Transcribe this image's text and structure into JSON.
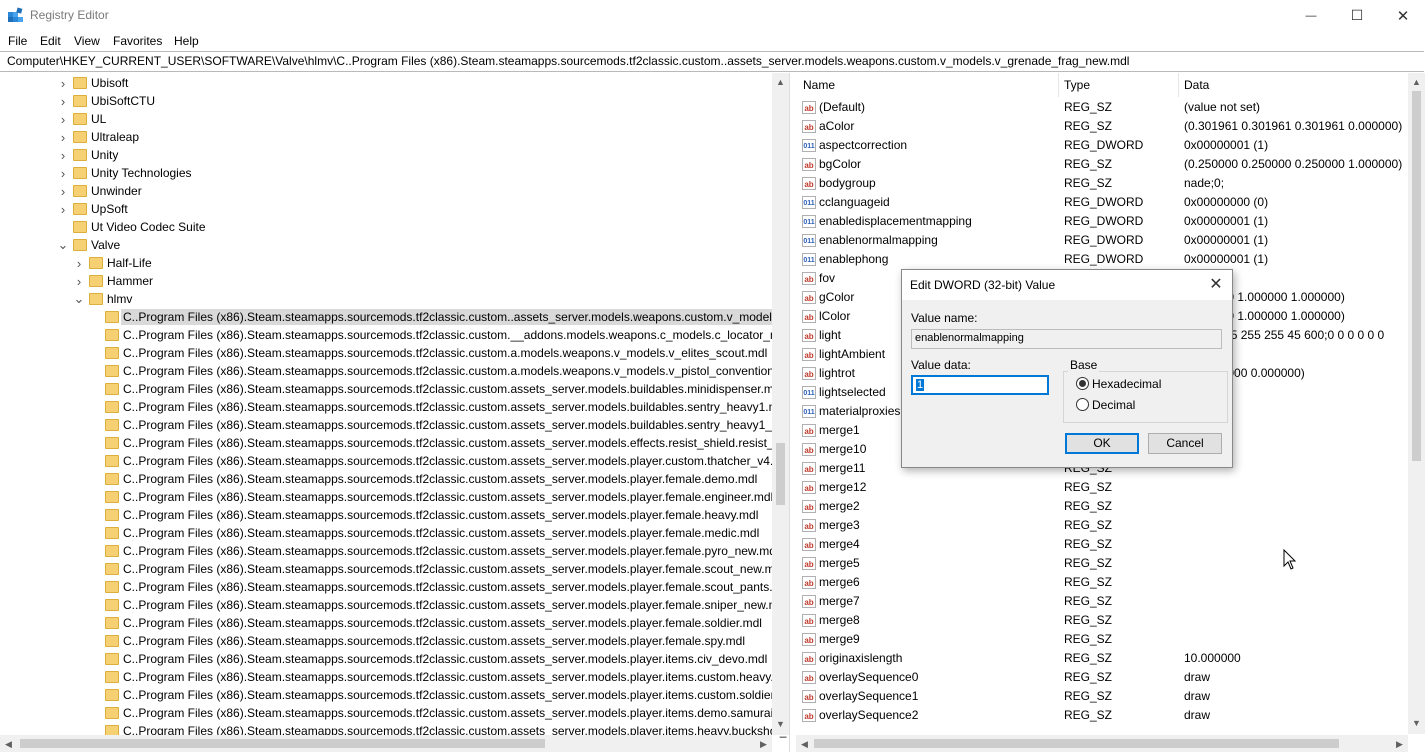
{
  "window": {
    "title": "Registry Editor",
    "minimize_glyph": "—",
    "maximize_glyph": "☐",
    "close_glyph": "✕"
  },
  "menu": [
    "File",
    "Edit",
    "View",
    "Favorites",
    "Help"
  ],
  "address": "Computer\\HKEY_CURRENT_USER\\SOFTWARE\\Valve\\hlmv\\C..Program Files (x86).Steam.steamapps.sourcemods.tf2classic.custom..assets_server.models.weapons.custom.v_models.v_grenade_frag_new.mdl",
  "tree": {
    "items": [
      {
        "label": "Ubisoft",
        "level": 0,
        "expander": "collapsed"
      },
      {
        "label": "UbiSoftCTU",
        "level": 0,
        "expander": "collapsed"
      },
      {
        "label": "UL",
        "level": 0,
        "expander": "collapsed"
      },
      {
        "label": "Ultraleap",
        "level": 0,
        "expander": "collapsed"
      },
      {
        "label": "Unity",
        "level": 0,
        "expander": "collapsed"
      },
      {
        "label": "Unity Technologies",
        "level": 0,
        "expander": "collapsed"
      },
      {
        "label": "Unwinder",
        "level": 0,
        "expander": "collapsed"
      },
      {
        "label": "UpSoft",
        "level": 0,
        "expander": "collapsed"
      },
      {
        "label": "Ut Video Codec Suite",
        "level": 0,
        "expander": "none"
      },
      {
        "label": "Valve",
        "level": 0,
        "expander": "expanded"
      },
      {
        "label": "Half-Life",
        "level": 1,
        "expander": "collapsed"
      },
      {
        "label": "Hammer",
        "level": 1,
        "expander": "collapsed"
      },
      {
        "label": "hlmv",
        "level": 1,
        "expander": "expanded"
      },
      {
        "label": "C..Program Files (x86).Steam.steamapps.sourcemods.tf2classic.custom..assets_server.models.weapons.custom.v_models.v_",
        "level": 2,
        "expander": "none",
        "selected": true
      },
      {
        "label": "C..Program Files (x86).Steam.steamapps.sourcemods.tf2classic.custom.__addons.models.weapons.c_models.c_locator_nade",
        "level": 2,
        "expander": "none"
      },
      {
        "label": "C..Program Files (x86).Steam.steamapps.sourcemods.tf2classic.custom.a.models.weapons.v_models.v_elites_scout.mdl",
        "level": 2,
        "expander": "none"
      },
      {
        "label": "C..Program Files (x86).Steam.steamapps.sourcemods.tf2classic.custom.a.models.weapons.v_models.v_pistol_conventional_",
        "level": 2,
        "expander": "none"
      },
      {
        "label": "C..Program Files (x86).Steam.steamapps.sourcemods.tf2classic.custom.assets_server.models.buildables.minidispenser.mdl",
        "level": 2,
        "expander": "none"
      },
      {
        "label": "C..Program Files (x86).Steam.steamapps.sourcemods.tf2classic.custom.assets_server.models.buildables.sentry_heavy1.mdl",
        "level": 2,
        "expander": "none"
      },
      {
        "label": "C..Program Files (x86).Steam.steamapps.sourcemods.tf2classic.custom.assets_server.models.buildables.sentry_heavy1_build",
        "level": 2,
        "expander": "none"
      },
      {
        "label": "C..Program Files (x86).Steam.steamapps.sourcemods.tf2classic.custom.assets_server.models.effects.resist_shield.resist_shiel",
        "level": 2,
        "expander": "none"
      },
      {
        "label": "C..Program Files (x86).Steam.steamapps.sourcemods.tf2classic.custom.assets_server.models.player.custom.thatcher_v4.mdl",
        "level": 2,
        "expander": "none"
      },
      {
        "label": "C..Program Files (x86).Steam.steamapps.sourcemods.tf2classic.custom.assets_server.models.player.female.demo.mdl",
        "level": 2,
        "expander": "none"
      },
      {
        "label": "C..Program Files (x86).Steam.steamapps.sourcemods.tf2classic.custom.assets_server.models.player.female.engineer.mdl",
        "level": 2,
        "expander": "none"
      },
      {
        "label": "C..Program Files (x86).Steam.steamapps.sourcemods.tf2classic.custom.assets_server.models.player.female.heavy.mdl",
        "level": 2,
        "expander": "none"
      },
      {
        "label": "C..Program Files (x86).Steam.steamapps.sourcemods.tf2classic.custom.assets_server.models.player.female.medic.mdl",
        "level": 2,
        "expander": "none"
      },
      {
        "label": "C..Program Files (x86).Steam.steamapps.sourcemods.tf2classic.custom.assets_server.models.player.female.pyro_new.mdl",
        "level": 2,
        "expander": "none"
      },
      {
        "label": "C..Program Files (x86).Steam.steamapps.sourcemods.tf2classic.custom.assets_server.models.player.female.scout_new.mdl",
        "level": 2,
        "expander": "none"
      },
      {
        "label": "C..Program Files (x86).Steam.steamapps.sourcemods.tf2classic.custom.assets_server.models.player.female.scout_pants.mdl",
        "level": 2,
        "expander": "none"
      },
      {
        "label": "C..Program Files (x86).Steam.steamapps.sourcemods.tf2classic.custom.assets_server.models.player.female.sniper_new.mdl",
        "level": 2,
        "expander": "none"
      },
      {
        "label": "C..Program Files (x86).Steam.steamapps.sourcemods.tf2classic.custom.assets_server.models.player.female.soldier.mdl",
        "level": 2,
        "expander": "none"
      },
      {
        "label": "C..Program Files (x86).Steam.steamapps.sourcemods.tf2classic.custom.assets_server.models.player.female.spy.mdl",
        "level": 2,
        "expander": "none"
      },
      {
        "label": "C..Program Files (x86).Steam.steamapps.sourcemods.tf2classic.custom.assets_server.models.player.items.civ_devo.mdl",
        "level": 2,
        "expander": "none"
      },
      {
        "label": "C..Program Files (x86).Steam.steamapps.sourcemods.tf2classic.custom.assets_server.models.player.items.custom.heavy.hea",
        "level": 2,
        "expander": "none"
      },
      {
        "label": "C..Program Files (x86).Steam.steamapps.sourcemods.tf2classic.custom.assets_server.models.player.items.custom.soldier.go",
        "level": 2,
        "expander": "none"
      },
      {
        "label": "C..Program Files (x86).Steam.steamapps.sourcemods.tf2classic.custom.assets_server.models.player.items.demo.samuraiplat",
        "level": 2,
        "expander": "none"
      },
      {
        "label": "C..Program Files (x86).Steam.steamapps.sourcemods.tf2classic.custom.assets_server.models.player.items.heavy.buckshot_a",
        "level": 2,
        "expander": "none"
      }
    ]
  },
  "list": {
    "headers": {
      "name": "Name",
      "type": "Type",
      "data": "Data"
    },
    "rows": [
      {
        "icon": "string",
        "name": "(Default)",
        "type": "REG_SZ",
        "data": "(value not set)"
      },
      {
        "icon": "string",
        "name": "aColor",
        "type": "REG_SZ",
        "data": "(0.301961 0.301961 0.301961 0.000000)"
      },
      {
        "icon": "dword",
        "name": "aspectcorrection",
        "type": "REG_DWORD",
        "data": "0x00000001 (1)"
      },
      {
        "icon": "string",
        "name": "bgColor",
        "type": "REG_SZ",
        "data": "(0.250000 0.250000 0.250000 1.000000)"
      },
      {
        "icon": "string",
        "name": "bodygroup",
        "type": "REG_SZ",
        "data": "nade;0;"
      },
      {
        "icon": "dword",
        "name": "cclanguageid",
        "type": "REG_DWORD",
        "data": "0x00000000 (0)"
      },
      {
        "icon": "dword",
        "name": "enabledisplacementmapping",
        "type": "REG_DWORD",
        "data": "0x00000001 (1)"
      },
      {
        "icon": "dword",
        "name": "enablenormalmapping",
        "type": "REG_DWORD",
        "data": "0x00000001 (1)"
      },
      {
        "icon": "dword",
        "name": "enablephong",
        "type": "REG_DWORD",
        "data": "0x00000001 (1)"
      },
      {
        "icon": "string",
        "name": "fov",
        "type": "",
        "data": "0"
      },
      {
        "icon": "string",
        "name": "gColor",
        "type": "",
        "data": "1.000000 1.000000 1.000000)"
      },
      {
        "icon": "string",
        "name": "lColor",
        "type": "",
        "data": "1.000000 1.000000 1.000000)"
      },
      {
        "icon": "string",
        "name": "light",
        "type": "",
        "data": "180 0 255 255 255 45 600;0 0 0 0 0 0"
      },
      {
        "icon": "string",
        "name": "lightAmbient",
        "type": "",
        "data": ")"
      },
      {
        "icon": "string",
        "name": "lightrot",
        "type": "",
        "data": "180.000000 0.000000)"
      },
      {
        "icon": "dword",
        "name": "lightselected",
        "type": "",
        "data": "00 (0)"
      },
      {
        "icon": "dword",
        "name": "materialproxies",
        "type": "",
        "data": "01 (1)"
      },
      {
        "icon": "string",
        "name": "merge1",
        "type": "",
        "data": ""
      },
      {
        "icon": "string",
        "name": "merge10",
        "type": "",
        "data": ""
      },
      {
        "icon": "string",
        "name": "merge11",
        "type": "REG_SZ",
        "data": ""
      },
      {
        "icon": "string",
        "name": "merge12",
        "type": "REG_SZ",
        "data": ""
      },
      {
        "icon": "string",
        "name": "merge2",
        "type": "REG_SZ",
        "data": ""
      },
      {
        "icon": "string",
        "name": "merge3",
        "type": "REG_SZ",
        "data": ""
      },
      {
        "icon": "string",
        "name": "merge4",
        "type": "REG_SZ",
        "data": ""
      },
      {
        "icon": "string",
        "name": "merge5",
        "type": "REG_SZ",
        "data": ""
      },
      {
        "icon": "string",
        "name": "merge6",
        "type": "REG_SZ",
        "data": ""
      },
      {
        "icon": "string",
        "name": "merge7",
        "type": "REG_SZ",
        "data": ""
      },
      {
        "icon": "string",
        "name": "merge8",
        "type": "REG_SZ",
        "data": ""
      },
      {
        "icon": "string",
        "name": "merge9",
        "type": "REG_SZ",
        "data": ""
      },
      {
        "icon": "string",
        "name": "originaxislength",
        "type": "REG_SZ",
        "data": "10.000000"
      },
      {
        "icon": "string",
        "name": "overlaySequence0",
        "type": "REG_SZ",
        "data": "draw"
      },
      {
        "icon": "string",
        "name": "overlaySequence1",
        "type": "REG_SZ",
        "data": "draw"
      },
      {
        "icon": "string",
        "name": "overlaySequence2",
        "type": "REG_SZ",
        "data": "draw"
      }
    ]
  },
  "icons": {
    "string": "ab",
    "dword": "011"
  },
  "dialog": {
    "title": "Edit DWORD (32-bit) Value",
    "value_name_label": "Value name:",
    "value_name": "enablenormalmapping",
    "value_data_label": "Value data:",
    "value_data": "1",
    "base_label": "Base",
    "hex_label": "Hexadecimal",
    "dec_label": "Decimal",
    "base_selected": "Hexadecimal",
    "ok_label": "OK",
    "cancel_label": "Cancel",
    "close_glyph": "✕"
  },
  "colors": {
    "accent": "#0078d7",
    "folder": "#f6d174",
    "selection": "#d9d9d9"
  }
}
